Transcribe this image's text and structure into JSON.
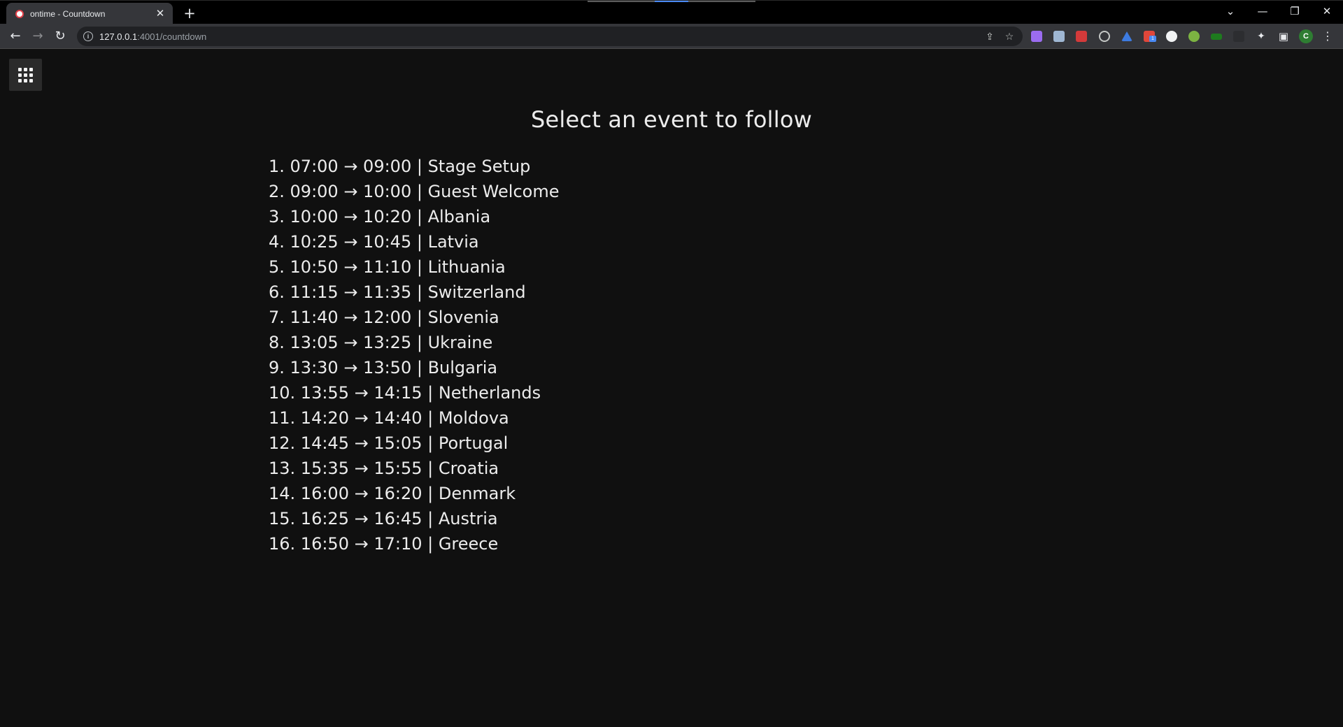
{
  "browser": {
    "tab_title": "ontime - Countdown",
    "tab_close": "✕",
    "new_tab": "+",
    "url_host": "127.0.0.1",
    "url_path": ":4001/countdown",
    "profile_initial": "C",
    "extension_badge": "1",
    "window_controls": {
      "tab_search": "⌄",
      "minimize": "—",
      "restore": "❐",
      "close": "✕"
    },
    "icons": {
      "back": "←",
      "forward": "→",
      "reload": "↻",
      "info": "i",
      "share": "⇪",
      "bookmark": "☆",
      "extensions": "✦",
      "side_panel": "▣",
      "menu": "⋮"
    }
  },
  "page": {
    "title": "Select an event to follow",
    "events": [
      "1. 07:00 → 09:00 | Stage Setup",
      "2. 09:00 → 10:00 | Guest Welcome",
      "3. 10:00 → 10:20 | Albania",
      "4. 10:25 → 10:45 | Latvia",
      "5. 10:50 → 11:10 | Lithuania",
      "6. 11:15 → 11:35 | Switzerland",
      "7. 11:40 → 12:00 | Slovenia",
      "8. 13:05 → 13:25 | Ukraine",
      "9. 13:30 → 13:50 | Bulgaria",
      "10. 13:55 → 14:15 | Netherlands",
      "11. 14:20 → 14:40 | Moldova",
      "12. 14:45 → 15:05 | Portugal",
      "13. 15:35 → 15:55 | Croatia",
      "14. 16:00 → 16:20 | Denmark",
      "15. 16:25 → 16:45 | Austria",
      "16. 16:50 → 17:10 | Greece"
    ]
  },
  "colors": {
    "page_background": "#101010",
    "text": "#ececec",
    "menu_button_background": "#2b2b2b",
    "chrome_tabbar": "#000000",
    "chrome_toolbar": "#35363a",
    "omnibox": "#202124"
  }
}
